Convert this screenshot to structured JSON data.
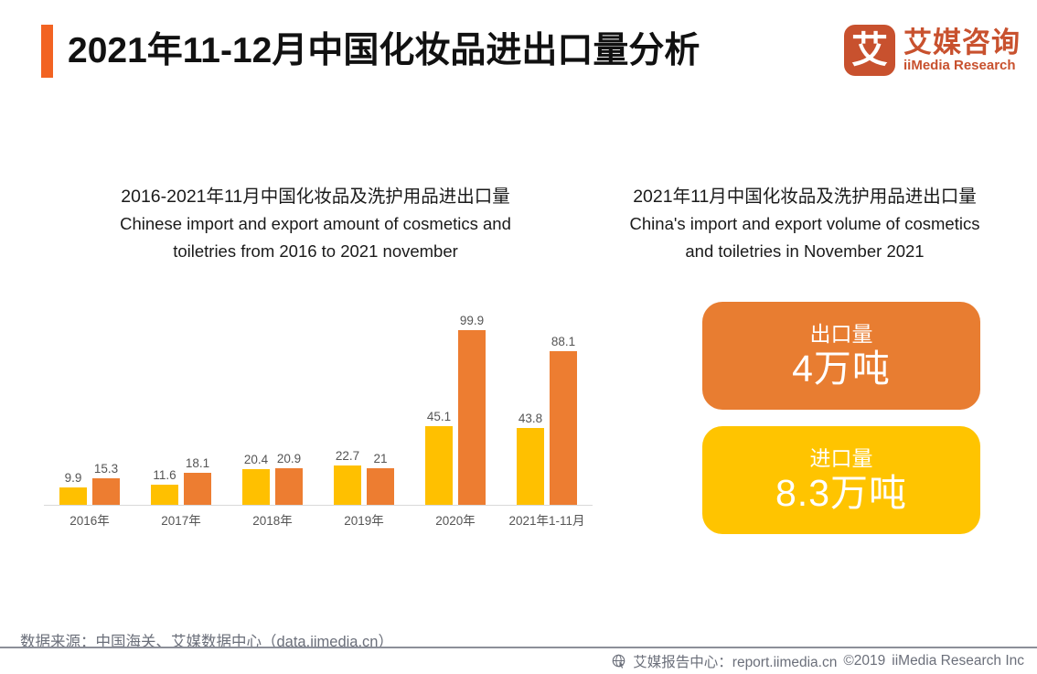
{
  "header": {
    "title": "2021年11-12月中国化妆品进出口量分析",
    "accent_color": "#F26322",
    "logo": {
      "mark_glyph": "艾",
      "name_cn": "艾媒咨询",
      "name_en": "iiMedia Research",
      "color": "#C8512E"
    }
  },
  "left_panel": {
    "title_cn": "2016-2021年11月中国化妆品及洗护用品进出口量",
    "title_en_line1": "Chinese import and export amount of cosmetics and",
    "title_en_line2": "toiletries from 2016 to 2021 november"
  },
  "right_panel": {
    "title_cn": "2021年11月中国化妆品及洗护用品进出口量",
    "title_en_line1": "China's import and export volume of cosmetics",
    "title_en_line2": "and toiletries in November 2021",
    "cards": [
      {
        "label": "出口量",
        "value": "4万吨",
        "color": "#E87D31"
      },
      {
        "label": "进口量",
        "value": "8.3万吨",
        "color": "#FFC400"
      }
    ]
  },
  "footer": {
    "source": "数据来源：中国海关、艾媒数据中心（data.iimedia.cn）",
    "report_center": "艾媒报告中心：report.iimedia.cn",
    "copyright": "©2019",
    "company": "iiMedia Research  Inc"
  },
  "chart_data": {
    "type": "bar",
    "title": "2016-2021年11月中国化妆品及洗护用品进出口量",
    "xlabel": "",
    "ylabel": "",
    "ylim": [
      0,
      110
    ],
    "grid": false,
    "legend": "none",
    "categories": [
      "2016年",
      "2017年",
      "2018年",
      "2019年",
      "2020年",
      "2021年1-11月"
    ],
    "series": [
      {
        "name": "出口量",
        "color": "#FFC000",
        "values": [
          9.9,
          11.6,
          20.4,
          22.7,
          45.1,
          43.8
        ]
      },
      {
        "name": "进口量",
        "color": "#ED7D31",
        "values": [
          15.3,
          18.1,
          20.9,
          21,
          99.9,
          88.1
        ]
      }
    ],
    "value_labels": [
      [
        "9.9",
        "15.3"
      ],
      [
        "11.6",
        "18.1"
      ],
      [
        "20.4",
        "20.9"
      ],
      [
        "22.7",
        "21"
      ],
      [
        "45.1",
        "99.9"
      ],
      [
        "43.8",
        "88.1"
      ]
    ]
  }
}
